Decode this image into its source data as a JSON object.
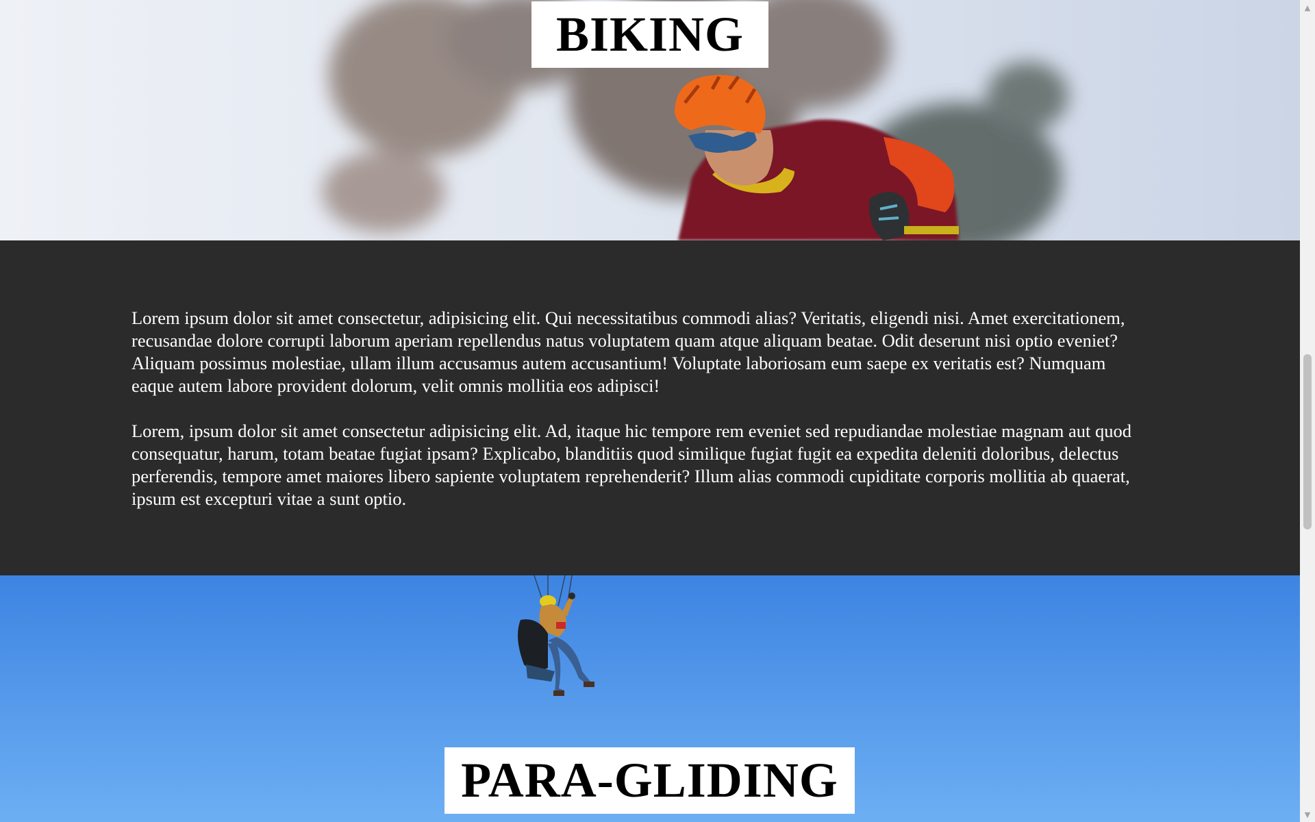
{
  "sections": {
    "biking": {
      "title": "BIKING",
      "image": "mountain-biker-photo"
    },
    "text_band": {
      "paragraphs": [
        "Lorem ipsum dolor sit amet consectetur, adipisicing elit. Qui necessitatibus commodi alias? Veritatis, eligendi nisi. Amet exercitationem, recusandae dolore corrupti laborum aperiam repellendus natus voluptatem quam atque aliquam beatae. Odit deserunt nisi optio eveniet? Aliquam possimus molestiae, ullam illum accusamus autem accusantium! Voluptate laboriosam eum saepe ex veritatis est? Numquam eaque autem labore provident dolorum, velit omnis mollitia eos adipisci!",
        "Lorem, ipsum dolor sit amet consectetur adipisicing elit. Ad, itaque hic tempore rem eveniet sed repudiandae molestiae magnam aut quod consequatur, harum, totam beatae fugiat ipsam? Explicabo, blanditiis quod similique fugiat fugit ea expedita deleniti doloribus, delectus perferendis, tempore amet maiores libero sapiente voluptatem reprehenderit? Illum alias commodi cupiditate corporis mollitia ab quaerat, ipsum est excepturi vitae a sunt optio."
      ]
    },
    "paragliding": {
      "title": "PARA-GLIDING",
      "image": "paraglider-photo"
    }
  },
  "scrollbar": {
    "up_icon": "triangle-up-icon",
    "down_icon": "triangle-down-icon",
    "up_glyph": "▲",
    "down_glyph": "▼",
    "position_fraction": 0.55
  },
  "colors": {
    "text_band_bg": "#2b2b2b",
    "text_color": "#ffffff",
    "title_bg": "#ffffff",
    "sky_blue": "#4d93ea"
  }
}
